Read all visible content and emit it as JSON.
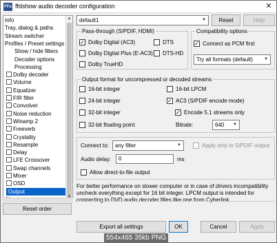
{
  "window": {
    "title": "ffdshow audio decoder configuration",
    "app_icon": "FFa"
  },
  "preset": {
    "value": "default1",
    "reset_label": "Reset",
    "help_label": "Help"
  },
  "tree": {
    "items": [
      {
        "label": "Info",
        "checkbox": false,
        "checked": false
      },
      {
        "label": "Tray, dialog & paths",
        "checkbox": false,
        "checked": false
      },
      {
        "label": "Stream switcher",
        "checkbox": false,
        "checked": false
      },
      {
        "label": "Profiles / Preset settings",
        "checkbox": false,
        "checked": false
      },
      {
        "label": "Show / hide filters",
        "checkbox": false,
        "checked": false,
        "indent": true
      },
      {
        "label": "Decoder options",
        "checkbox": false,
        "checked": false,
        "indent": true
      },
      {
        "label": "Processing",
        "checkbox": false,
        "checked": false,
        "indent": true
      },
      {
        "label": "Dolby decoder",
        "checkbox": true,
        "checked": false
      },
      {
        "label": "Volume",
        "checkbox": true,
        "checked": false
      },
      {
        "label": "Equalizer",
        "checkbox": true,
        "checked": false
      },
      {
        "label": "FIR filter",
        "checkbox": true,
        "checked": false
      },
      {
        "label": "Convolver",
        "checkbox": true,
        "checked": false
      },
      {
        "label": "Noise reduction",
        "checkbox": true,
        "checked": false
      },
      {
        "label": "Winamp 2",
        "checkbox": true,
        "checked": false
      },
      {
        "label": "Freeverb",
        "checkbox": true,
        "checked": false
      },
      {
        "label": "Crystality",
        "checkbox": true,
        "checked": false
      },
      {
        "label": "Resample",
        "checkbox": true,
        "checked": false
      },
      {
        "label": "Delay",
        "checkbox": true,
        "checked": false
      },
      {
        "label": "LFE Crossover",
        "checkbox": true,
        "checked": false
      },
      {
        "label": "Swap channels",
        "checkbox": true,
        "checked": false
      },
      {
        "label": "Mixer",
        "checkbox": true,
        "checked": false
      },
      {
        "label": "OSD",
        "checkbox": true,
        "checked": false
      },
      {
        "label": "Output",
        "checkbox": false,
        "checked": false,
        "selected": true
      },
      {
        "label": "About",
        "checkbox": false,
        "checked": false
      }
    ],
    "reset_order_label": "Reset order"
  },
  "passthrough": {
    "title": "Pass-through (S/PDIF, HDMI)",
    "options": [
      {
        "label": "Dolby Digital (AC3)",
        "checked": true
      },
      {
        "label": "DTS",
        "checked": false
      },
      {
        "label": "Dolby Digital Plus (E-AC3)",
        "checked": false
      },
      {
        "label": "DTS-HD",
        "checked": false
      },
      {
        "label": "Dolby TrueHD",
        "checked": false
      }
    ]
  },
  "compat": {
    "title": "Compatibility options",
    "connect_pcm_label": "Connect as PCM first",
    "connect_pcm_checked": true,
    "formats_value": "Try all formats (default)"
  },
  "output_format": {
    "title": "Output format for uncompressed or decoded streams",
    "options": [
      {
        "label": "16-bit integer",
        "checked": false
      },
      {
        "label": "16-bit LPCM",
        "checked": false
      },
      {
        "label": "24-bit integer",
        "checked": false
      },
      {
        "label": "AC3 (S/PDIF encode mode)",
        "checked": true
      },
      {
        "label": "32-bit integer",
        "checked": false
      },
      {
        "label": "Encode 5.1 streams only",
        "checked": true
      },
      {
        "label": "32-bit floating point",
        "checked": false
      }
    ],
    "bitrate_label": "Bitrate:",
    "bitrate_value": "640"
  },
  "connect": {
    "connect_to_label": "Connect to:",
    "connect_to_value": "any filter",
    "apply_spdif_label": "Apply only to S/PDIF output",
    "audio_delay_label": "Audio delay:",
    "audio_delay_value": "0",
    "audio_delay_unit": "ms",
    "allow_direct_label": "Allow direct-to-file output"
  },
  "info_text": "For better performance on slower computer or in case of drivers incompatibility uncheck everything except for 16 bit integer. LPCM output is intended for connecting to DVD audio decoder filles like one from Cyberlink.",
  "bottom": {
    "export_label": "Export all settings",
    "ok_label": "OK",
    "cancel_label": "Cancel",
    "apply_label": "Apply"
  },
  "watermark": "554x465  35kb  PNG"
}
